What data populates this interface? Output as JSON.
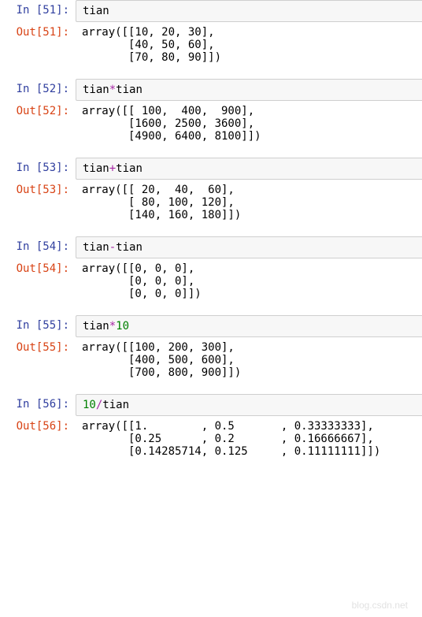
{
  "cells": [
    {
      "n": 51,
      "in_prompt": "In [51]:",
      "out_prompt": "Out[51]:",
      "code_parts": [
        {
          "t": "tian",
          "c": ""
        }
      ],
      "output": "array([[10, 20, 30],\n       [40, 50, 60],\n       [70, 80, 90]])"
    },
    {
      "n": 52,
      "in_prompt": "In [52]:",
      "out_prompt": "Out[52]:",
      "code_parts": [
        {
          "t": "tian",
          "c": ""
        },
        {
          "t": "*",
          "c": "op-mul"
        },
        {
          "t": "tian",
          "c": ""
        }
      ],
      "output": "array([[ 100,  400,  900],\n       [1600, 2500, 3600],\n       [4900, 6400, 8100]])"
    },
    {
      "n": 53,
      "in_prompt": "In [53]:",
      "out_prompt": "Out[53]:",
      "code_parts": [
        {
          "t": "tian",
          "c": ""
        },
        {
          "t": "+",
          "c": "op-add"
        },
        {
          "t": "tian",
          "c": ""
        }
      ],
      "output": "array([[ 20,  40,  60],\n       [ 80, 100, 120],\n       [140, 160, 180]])"
    },
    {
      "n": 54,
      "in_prompt": "In [54]:",
      "out_prompt": "Out[54]:",
      "code_parts": [
        {
          "t": "tian",
          "c": ""
        },
        {
          "t": "-",
          "c": "op-sub"
        },
        {
          "t": "tian",
          "c": ""
        }
      ],
      "output": "array([[0, 0, 0],\n       [0, 0, 0],\n       [0, 0, 0]])"
    },
    {
      "n": 55,
      "in_prompt": "In [55]:",
      "out_prompt": "Out[55]:",
      "code_parts": [
        {
          "t": "tian",
          "c": ""
        },
        {
          "t": "*",
          "c": "op-mul"
        },
        {
          "t": "10",
          "c": "num"
        }
      ],
      "output": "array([[100, 200, 300],\n       [400, 500, 600],\n       [700, 800, 900]])"
    },
    {
      "n": 56,
      "in_prompt": "In [56]:",
      "out_prompt": "Out[56]:",
      "code_parts": [
        {
          "t": "10",
          "c": "num"
        },
        {
          "t": "/",
          "c": "op-div"
        },
        {
          "t": "tian",
          "c": ""
        }
      ],
      "output": "array([[1.        , 0.5       , 0.33333333],\n       [0.25      , 0.2       , 0.16666667],\n       [0.14285714, 0.125     , 0.11111111]])"
    }
  ],
  "watermark": "blog.csdn.net"
}
